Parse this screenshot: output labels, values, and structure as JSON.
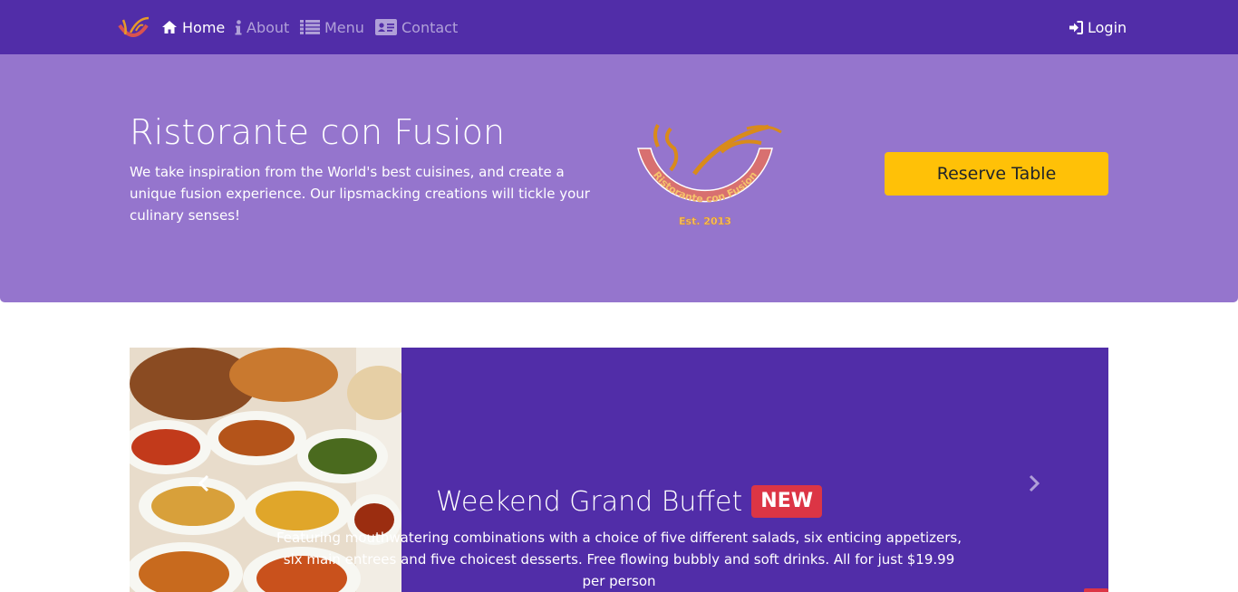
{
  "navbar": {
    "brand_logo_alt": "Ristorante con Fusion logo",
    "items": [
      {
        "label": "Home",
        "icon": "home-icon",
        "active": true
      },
      {
        "label": "About",
        "icon": "info-icon",
        "active": false
      },
      {
        "label": "Menu",
        "icon": "list-icon",
        "active": false
      },
      {
        "label": "Contact",
        "icon": "address-card-icon",
        "active": false
      }
    ],
    "login": {
      "label": "Login",
      "icon": "sign-in-icon"
    }
  },
  "jumbotron": {
    "title": "Ristorante con Fusion",
    "text": "We take inspiration from the World's best cuisines, and create a unique fusion experience. Our lipsmacking creations will tickle your culinary senses!",
    "logo": {
      "arc_text": "Ristorante con Fusion",
      "est_text": "Est. 2013"
    },
    "reserve_label": "Reserve Table"
  },
  "carousel": {
    "title": "Weekend Grand Buffet",
    "badge": "NEW",
    "text": "Featuring mouthwatering combinations with a choice of five different salads, six enticing appetizers, six main entrees and five choicest desserts. Free flowing bubbly and soft drinks. All for just $19.99 per person"
  },
  "colors": {
    "primary": "#512DA8",
    "primary_light": "#9575CD",
    "accent": "#FFC107",
    "badge": "#dc3545"
  }
}
